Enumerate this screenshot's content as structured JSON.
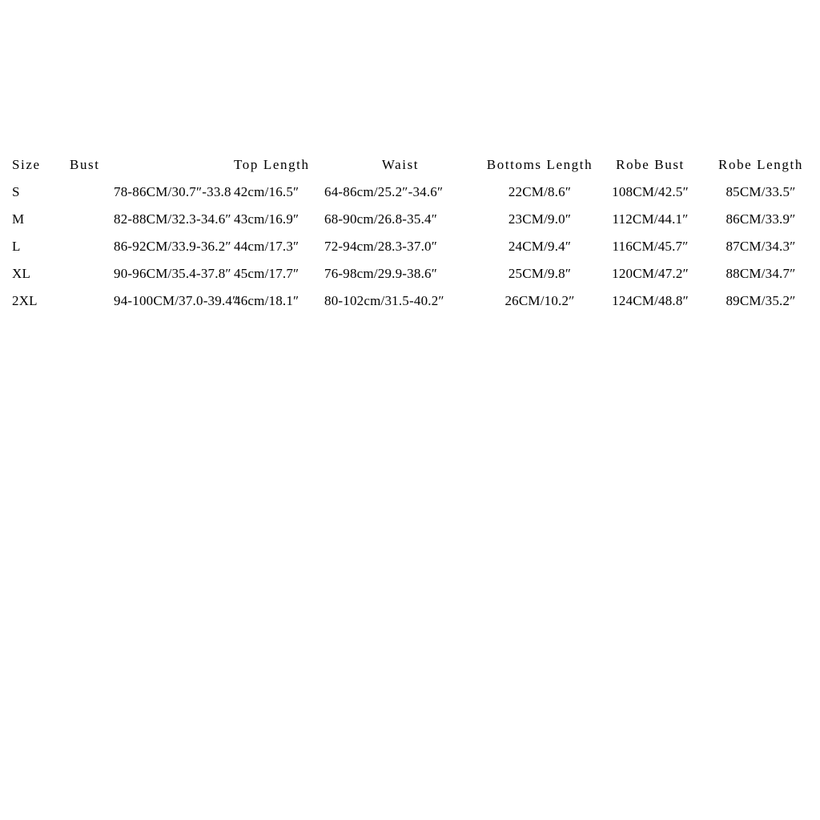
{
  "chart_data": {
    "type": "table",
    "title": "",
    "columns": [
      "Size",
      "Bust",
      "Top Length",
      "Waist",
      "Bottoms Length",
      "Robe Bust",
      "Robe Length"
    ],
    "rows": [
      {
        "size": "S",
        "bust": "78-86CM/30.7″-33.8",
        "top_length": "42cm/16.5″",
        "waist": "64-86cm/25.2″-34.6″",
        "bottoms_length": "22CM/8.6″",
        "robe_bust": "108CM/42.5″",
        "robe_length": "85CM/33.5″"
      },
      {
        "size": "M",
        "bust": "82-88CM/32.3-34.6″",
        "top_length": "43cm/16.9″",
        "waist": "68-90cm/26.8-35.4″",
        "bottoms_length": "23CM/9.0″",
        "robe_bust": "112CM/44.1″",
        "robe_length": "86CM/33.9″"
      },
      {
        "size": "L",
        "bust": "86-92CM/33.9-36.2″",
        "top_length": "44cm/17.3″",
        "waist": "72-94cm/28.3-37.0″",
        "bottoms_length": "24CM/9.4″",
        "robe_bust": "116CM/45.7″",
        "robe_length": "87CM/34.3″"
      },
      {
        "size": "XL",
        "bust": "90-96CM/35.4-37.8″",
        "top_length": "45cm/17.7″",
        "waist": "76-98cm/29.9-38.6″",
        "bottoms_length": "25CM/9.8″",
        "robe_bust": "120CM/47.2″",
        "robe_length": "88CM/34.7″"
      },
      {
        "size": "2XL",
        "bust": "94-100CM/37.0-39.4″",
        "top_length": "46cm/18.1″",
        "waist": "80-102cm/31.5-40.2″",
        "bottoms_length": "26CM/10.2″",
        "robe_bust": "124CM/48.8″",
        "robe_length": "89CM/35.2″"
      }
    ],
    "colors": {
      "background": "#ffffff",
      "text": "#000000"
    }
  }
}
